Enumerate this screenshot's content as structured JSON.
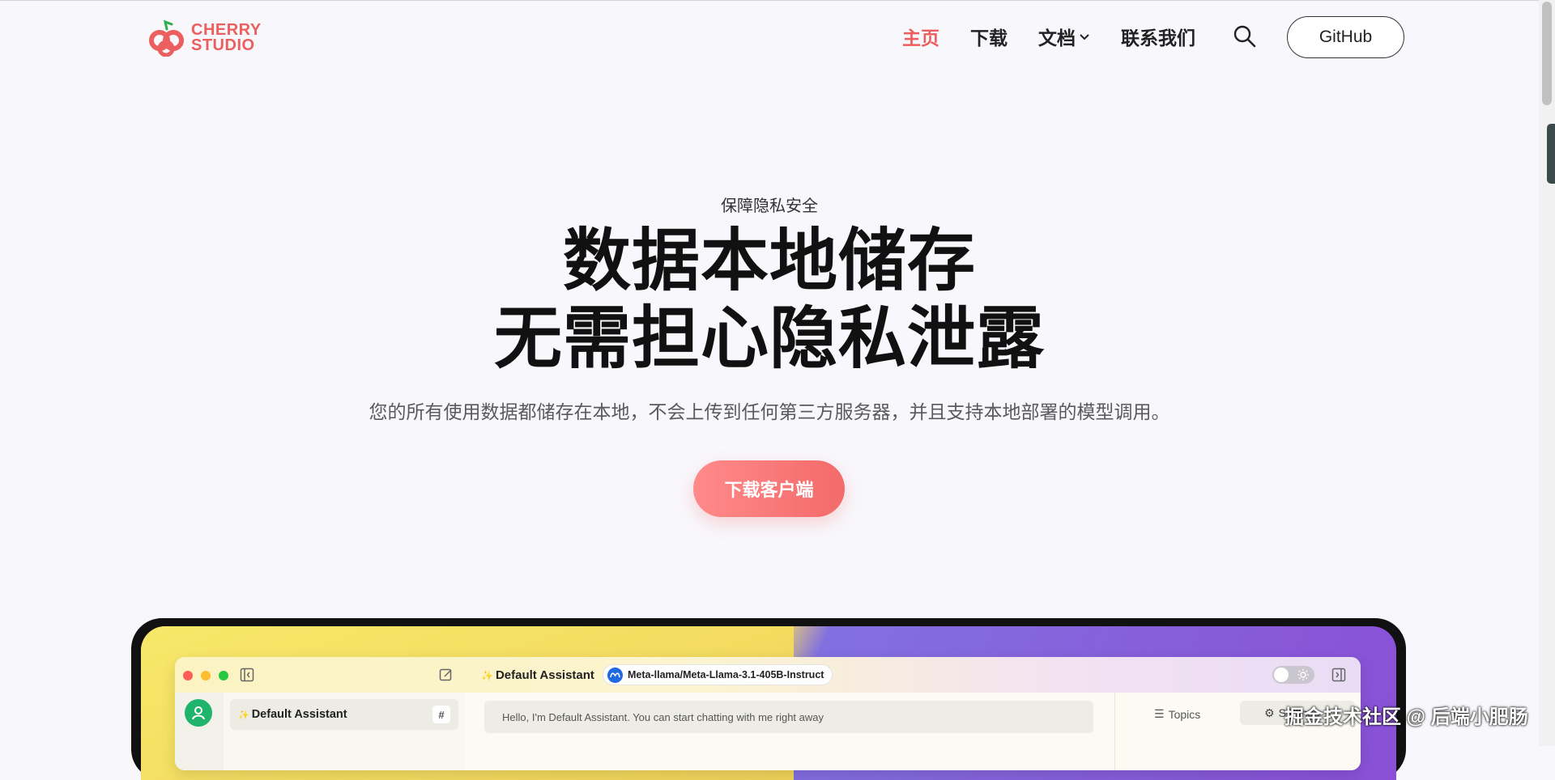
{
  "header": {
    "logo_text_line1": "CHERRY",
    "logo_text_line2": "STUDIO",
    "nav": [
      {
        "label": "主页",
        "active": true
      },
      {
        "label": "下载",
        "active": false
      },
      {
        "label": "文档",
        "active": false
      },
      {
        "label": "联系我们",
        "active": false
      }
    ],
    "github_label": "GitHub"
  },
  "hero": {
    "eyebrow": "保障隐私安全",
    "title_line1": "数据本地储存",
    "title_line2": "无需担心隐私泄露",
    "description": "您的所有使用数据都储存在本地，不会上传到任何第三方服务器，并且支持本地部署的模型调用。",
    "cta_label": "下载客户端"
  },
  "app_preview": {
    "assistant_title": "Default Assistant",
    "model_name": "Meta-llama/Meta-Llama-3.1-405B-Instruct",
    "list_item": "Default Assistant",
    "chat_message": "Hello, I'm Default Assistant. You can start chatting with me right away",
    "topics_tab": "Topics",
    "settings_tab": "Settings"
  },
  "watermark": "掘金技术社区 @ 后端小肥肠",
  "colors": {
    "brand": "#ec5f5f",
    "cta_gradient_start": "#ff8a8a",
    "cta_gradient_end": "#f36a6a"
  }
}
